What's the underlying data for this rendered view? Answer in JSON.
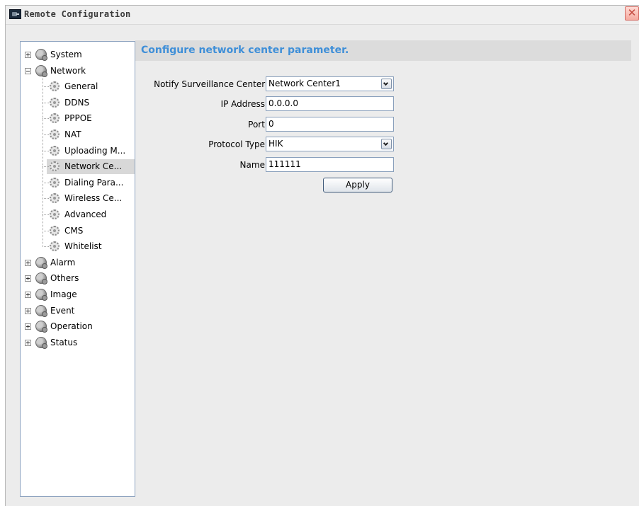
{
  "window": {
    "title": "Remote Configuration"
  },
  "tree": {
    "items": [
      {
        "label": "System",
        "level": 0,
        "expander": "plus",
        "icon": "globe-icon"
      },
      {
        "label": "Network",
        "level": 0,
        "expander": "minus",
        "icon": "globe-icon"
      },
      {
        "label": "General",
        "level": 1,
        "icon": "gear-icon"
      },
      {
        "label": "DDNS",
        "level": 1,
        "icon": "gear-icon"
      },
      {
        "label": "PPPOE",
        "level": 1,
        "icon": "gear-icon"
      },
      {
        "label": "NAT",
        "level": 1,
        "icon": "gear-icon"
      },
      {
        "label": "Uploading M...",
        "level": 1,
        "icon": "gear-icon"
      },
      {
        "label": "Network Ce...",
        "level": 1,
        "icon": "gear-icon",
        "selected": true
      },
      {
        "label": "Dialing Para...",
        "level": 1,
        "icon": "gear-icon"
      },
      {
        "label": "Wireless Ce...",
        "level": 1,
        "icon": "gear-icon"
      },
      {
        "label": "Advanced",
        "level": 1,
        "icon": "gear-icon"
      },
      {
        "label": "CMS",
        "level": 1,
        "icon": "gear-icon"
      },
      {
        "label": "Whitelist",
        "level": 1,
        "icon": "gear-icon"
      },
      {
        "label": "Alarm",
        "level": 0,
        "expander": "plus",
        "icon": "globe-icon"
      },
      {
        "label": "Others",
        "level": 0,
        "expander": "plus",
        "icon": "globe-icon"
      },
      {
        "label": "Image",
        "level": 0,
        "expander": "plus",
        "icon": "globe-icon"
      },
      {
        "label": "Event",
        "level": 0,
        "expander": "plus",
        "icon": "globe-icon"
      },
      {
        "label": "Operation",
        "level": 0,
        "expander": "plus",
        "icon": "globe-icon"
      },
      {
        "label": "Status",
        "level": 0,
        "expander": "plus",
        "icon": "globe-icon"
      }
    ]
  },
  "main": {
    "header": "Configure network center parameter.",
    "form": {
      "notify_label": "Notify Surveillance Center:",
      "notify_value": "Network Center1",
      "ip_label": "IP Address:",
      "ip_value": "0.0.0.0",
      "port_label": "Port:",
      "port_value": "0",
      "protocol_label": "Protocol Type:",
      "protocol_value": "HIK",
      "name_label": "Name:",
      "name_value": "111111"
    },
    "apply_label": "Apply"
  },
  "colors": {
    "header_text": "#3f8fd8",
    "header_bg": "#dcdcdc",
    "window_bg": "#ececec",
    "tree_border": "#8ea4c0",
    "selected_bg": "#d8d8d8"
  }
}
